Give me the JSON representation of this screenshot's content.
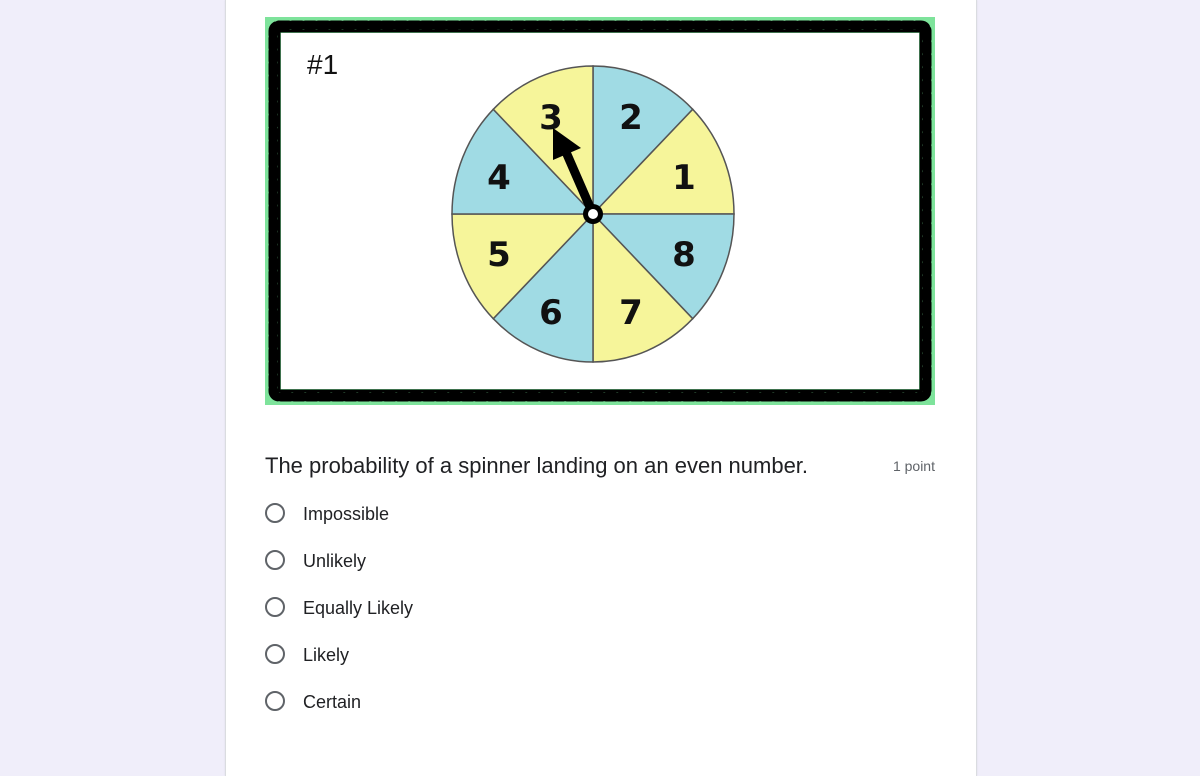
{
  "image": {
    "card_label": "#1",
    "spinner_numbers": [
      "1",
      "2",
      "3",
      "4",
      "5",
      "6",
      "7",
      "8"
    ],
    "colors": {
      "yellow": "#f6f59a",
      "blue": "#a0dbe4",
      "frame_green": "#7ee39b",
      "frame_black": "#000000"
    },
    "pointer_landed_on": "3"
  },
  "question": {
    "text": "The probability of a spinner landing on an even number.",
    "points": "1 point"
  },
  "options": [
    {
      "label": "Impossible"
    },
    {
      "label": "Unlikely"
    },
    {
      "label": "Equally Likely"
    },
    {
      "label": "Likely"
    },
    {
      "label": "Certain"
    }
  ]
}
